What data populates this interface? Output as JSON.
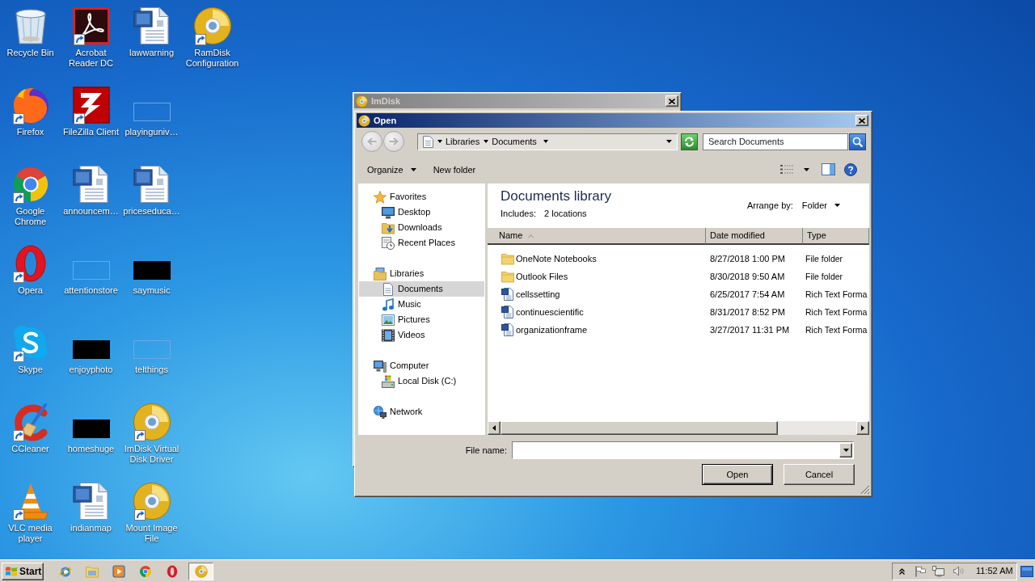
{
  "desktop": {
    "rows": [
      [
        {
          "label": "Recycle Bin",
          "kind": "recycle-bin",
          "shortcut": false
        },
        {
          "label": "Acrobat Reader DC",
          "kind": "acrobat",
          "shortcut": true
        },
        {
          "label": "lawwarning",
          "kind": "word-doc",
          "shortcut": false
        },
        {
          "label": "RamDisk Configuration",
          "kind": "disc",
          "shortcut": true
        }
      ],
      [
        {
          "label": "Firefox",
          "kind": "firefox",
          "shortcut": true
        },
        {
          "label": "FileZilla Client",
          "kind": "filezilla",
          "shortcut": true
        },
        {
          "label": "playinguniv…",
          "kind": "faint-thumb",
          "shortcut": false
        }
      ],
      [
        {
          "label": "Google Chrome",
          "kind": "chrome",
          "shortcut": true
        },
        {
          "label": "announcem…",
          "kind": "word-doc",
          "shortcut": false
        },
        {
          "label": "priceseduca…",
          "kind": "word-doc",
          "shortcut": false
        }
      ],
      [
        {
          "label": "Opera",
          "kind": "opera",
          "shortcut": true
        },
        {
          "label": "attentionstore",
          "kind": "faint-thumb",
          "shortcut": false
        },
        {
          "label": "saymusic",
          "kind": "black-thumb",
          "shortcut": false
        }
      ],
      [
        {
          "label": "Skype",
          "kind": "skype",
          "shortcut": true
        },
        {
          "label": "enjoyphoto",
          "kind": "black-thumb",
          "shortcut": false
        },
        {
          "label": "telthings",
          "kind": "faint-thumb",
          "shortcut": false
        }
      ],
      [
        {
          "label": "CCleaner",
          "kind": "ccleaner",
          "shortcut": true
        },
        {
          "label": "homeshuge",
          "kind": "black-thumb",
          "shortcut": false
        },
        {
          "label": "ImDisk Virtual Disk Driver",
          "kind": "disc",
          "shortcut": true
        }
      ],
      [
        {
          "label": "VLC media player",
          "kind": "vlc",
          "shortcut": true
        },
        {
          "label": "indianmap",
          "kind": "word-doc",
          "shortcut": false
        },
        {
          "label": "Mount Image File",
          "kind": "disc",
          "shortcut": true
        }
      ]
    ]
  },
  "background_window": {
    "title": "ImDisk",
    "active": false
  },
  "open_dialog": {
    "title": "Open",
    "active": true,
    "history": [
      {
        "kind": "back",
        "disabled": true
      },
      {
        "kind": "forward",
        "disabled": true
      }
    ],
    "breadcrumbs": [
      "Libraries",
      "Documents"
    ],
    "search": {
      "placeholder": "Search Documents"
    },
    "toolbar": [
      {
        "kind": "menu",
        "label": "Organize"
      },
      {
        "kind": "action",
        "label": "New folder"
      }
    ],
    "nav": [
      {
        "label": "Favorites",
        "kind": "star",
        "selected": false,
        "children": [
          {
            "label": "Desktop",
            "kind": "desktop",
            "selected": false
          },
          {
            "label": "Downloads",
            "kind": "downloads",
            "selected": false
          },
          {
            "label": "Recent Places",
            "kind": "recent",
            "selected": false
          }
        ]
      },
      {
        "label": "Libraries",
        "kind": "libraries",
        "selected": false,
        "children": [
          {
            "label": "Documents",
            "kind": "documents",
            "selected": true
          },
          {
            "label": "Music",
            "kind": "music",
            "selected": false
          },
          {
            "label": "Pictures",
            "kind": "pictures",
            "selected": false
          },
          {
            "label": "Videos",
            "kind": "videos",
            "selected": false
          }
        ]
      },
      {
        "label": "Computer",
        "kind": "computer",
        "selected": false,
        "children": [
          {
            "label": "Local Disk (C:)",
            "kind": "disk",
            "selected": false
          }
        ]
      },
      {
        "label": "Network",
        "kind": "network",
        "selected": false
      }
    ],
    "library": {
      "title": "Documents library",
      "includes_label": "Includes:",
      "includes_link": "2 locations",
      "arrange_label": "Arrange by:",
      "arrange_value": "Folder"
    },
    "columns": [
      {
        "label": "Name",
        "sorted": true
      },
      {
        "label": "Date modified",
        "sorted": false
      },
      {
        "label": "Type",
        "sorted": false
      }
    ],
    "files": [
      {
        "name": "OneNote Notebooks",
        "date": "8/27/2018 1:00 PM",
        "type": "File folder",
        "kind": "folder"
      },
      {
        "name": "Outlook Files",
        "date": "8/30/2018 9:50 AM",
        "type": "File folder",
        "kind": "folder"
      },
      {
        "name": "cellssetting",
        "date": "6/25/2017 7:54 AM",
        "type": "Rich Text Forma",
        "kind": "document"
      },
      {
        "name": "continuescientific",
        "date": "8/31/2017 8:52 PM",
        "type": "Rich Text Forma",
        "kind": "document"
      },
      {
        "name": "organizationframe",
        "date": "3/27/2017 11:31 PM",
        "type": "Rich Text Forma",
        "kind": "document"
      }
    ],
    "file_name": {
      "label": "File name:"
    },
    "buttons": [
      {
        "label": "Open",
        "default": true
      },
      {
        "label": "Cancel",
        "default": false
      }
    ]
  },
  "taskbar": {
    "start": "Start",
    "quick_launch": [
      {
        "kind": "ie"
      },
      {
        "kind": "explorer"
      },
      {
        "kind": "media"
      },
      {
        "kind": "chrome"
      },
      {
        "kind": "opera"
      }
    ],
    "tasks": [
      {
        "kind": "disc",
        "selected": true
      }
    ],
    "clock": "11:52 AM"
  }
}
